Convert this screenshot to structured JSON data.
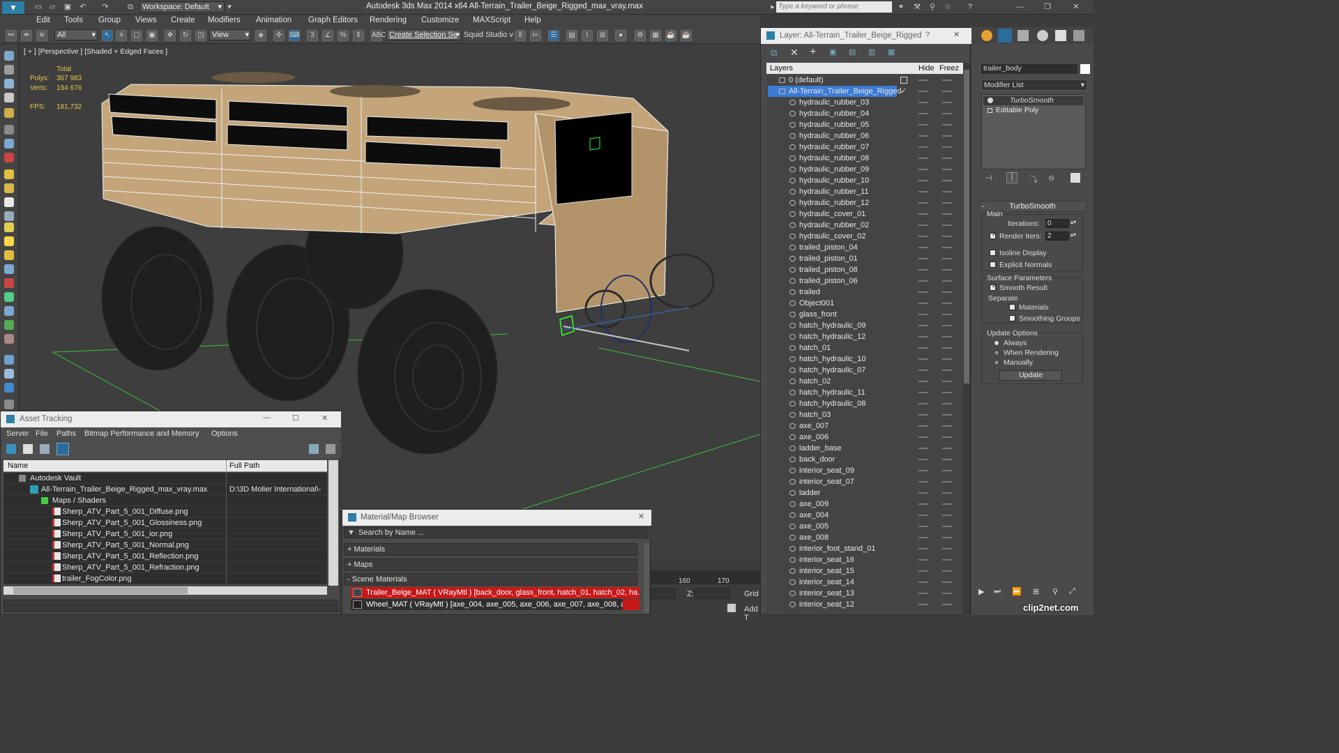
{
  "app": {
    "window_title": "Autodesk 3ds Max  2014 x64      All-Terrain_Trailer_Beige_Rigged_max_vray.max",
    "workspace": "Workspace: Default",
    "search_placeholder": "Type a keyword or phrase"
  },
  "menu": [
    "Edit",
    "Tools",
    "Group",
    "Views",
    "Create",
    "Modifiers",
    "Animation",
    "Graph Editors",
    "Rendering",
    "Customize",
    "MAXScript",
    "Help"
  ],
  "toolbar": {
    "filter": "All",
    "refcoord": "View",
    "selection_set": "Create Selection Se",
    "squid": "Squid Studio v"
  },
  "viewport": {
    "label": "[ + ] [Perspective ] [Shaded + Edged Faces ]",
    "stats_total": "Total",
    "polys_label": "Polys:",
    "polys_value": "367 983",
    "verts_label": "Verts:",
    "verts_value": "194 676",
    "fps_label": "FPS:",
    "fps_value": "181,732"
  },
  "asset_tracking": {
    "title": "Asset Tracking",
    "menu": [
      "Server",
      "File",
      "Paths",
      "Bitmap Performance and Memory",
      "Options"
    ],
    "col_name": "Name",
    "col_path": "Full Path",
    "rows": [
      {
        "name": "Autodesk Vault",
        "path": ""
      },
      {
        "name": "All-Terrain_Trailer_Beige_Rigged_max_vray.max",
        "path": "D:\\3D Molier International\\-"
      },
      {
        "name": "Maps / Shaders",
        "path": ""
      },
      {
        "name": "Sherp_ATV_Part_5_001_Diffuse.png",
        "path": ""
      },
      {
        "name": "Sherp_ATV_Part_5_001_Glossiness.png",
        "path": ""
      },
      {
        "name": "Sherp_ATV_Part_5_001_ior.png",
        "path": ""
      },
      {
        "name": "Sherp_ATV_Part_5_001_Normal.png",
        "path": ""
      },
      {
        "name": "Sherp_ATV_Part_5_001_Reflection.png",
        "path": ""
      },
      {
        "name": "Sherp_ATV_Part_5_001_Refraction.png",
        "path": ""
      },
      {
        "name": "trailer_FogColor.png",
        "path": ""
      }
    ]
  },
  "material_browser": {
    "title": "Material/Map Browser",
    "search": "Search by Name ...",
    "sec_materials": "+ Materials",
    "sec_maps": "+ Maps",
    "sec_scene": "- Scene Materials",
    "mat1": "Trailer_Beige_MAT  ( VRayMtl )  [back_door, glass_front, hatch_01, hatch_02, ha...",
    "mat2": "Wheel_MAT  ( VRayMtl )  [axe_004, axe_005, axe_006, axe_007, axe_008, axe_..."
  },
  "timeline": {
    "t160": "160",
    "t170": "170",
    "z_label": "Z:",
    "grid": "Grid",
    "addt": "Add T"
  },
  "layer_panel": {
    "title": "Layer: All-Terrain_Trailer_Beige_Rigged",
    "help": "?",
    "col_layers": "Layers",
    "col_hide": "Hide",
    "col_freeze": "Freez",
    "default_layer": "0 (default)",
    "active_layer": "All-Terrain_Trailer_Beige_Rigged",
    "objects": [
      "hydraulic_rubber_03",
      "hydraulic_rubber_04",
      "hydraulic_rubber_05",
      "hydraulic_rubber_06",
      "hydraulic_rubber_07",
      "hydraulic_rubber_08",
      "hydraulic_rubber_09",
      "hydraulic_rubber_10",
      "hydraulic_rubber_11",
      "hydraulic_rubber_12",
      "hydraulic_cover_01",
      "hydraulic_rubber_02",
      "hydraulic_cover_02",
      "trailed_piston_04",
      "trailed_piston_01",
      "trailed_piston_08",
      "trailed_piston_06",
      "trailed",
      "Object001",
      "glass_front",
      "hatch_hydraulic_09",
      "hatch_hydraulic_12",
      "hatch_01",
      "hatch_hydraulic_10",
      "hatch_hydraulic_07",
      "hatch_02",
      "hatch_hydraulic_11",
      "hatch_hydraulic_08",
      "hatch_03",
      "axe_007",
      "axe_006",
      "ladder_base",
      "back_door",
      "interior_seat_09",
      "interior_seat_07",
      "ladder",
      "axe_009",
      "axe_004",
      "axe_005",
      "axe_008",
      "interior_foot_stand_01",
      "interior_seat_16",
      "interior_seat_15",
      "interior_seat_14",
      "interior_seat_13",
      "interior_seat_12"
    ]
  },
  "command_panel": {
    "object_name": "trailer_body",
    "modifier_list": "Modifier List",
    "stack": [
      "TurboSmooth",
      "Editable Poly"
    ],
    "rollout": "TurboSmooth",
    "main": "Main",
    "iterations_label": "Iterations:",
    "iterations": "0",
    "render_iters_label": "Render Iters:",
    "render_iters": "2",
    "isoline": "Isoline Display",
    "explicit": "Explicit Normals",
    "surface": "Surface Parameters",
    "smooth_result": "Smooth Result",
    "separate": "Separate",
    "materials": "Materials",
    "smoothing_groups": "Smoothing Groups",
    "update_options": "Update Options",
    "always": "Always",
    "when_rendering": "When Rendering",
    "manually": "Manually",
    "update": "Update"
  },
  "watermark": "clip2net.com"
}
